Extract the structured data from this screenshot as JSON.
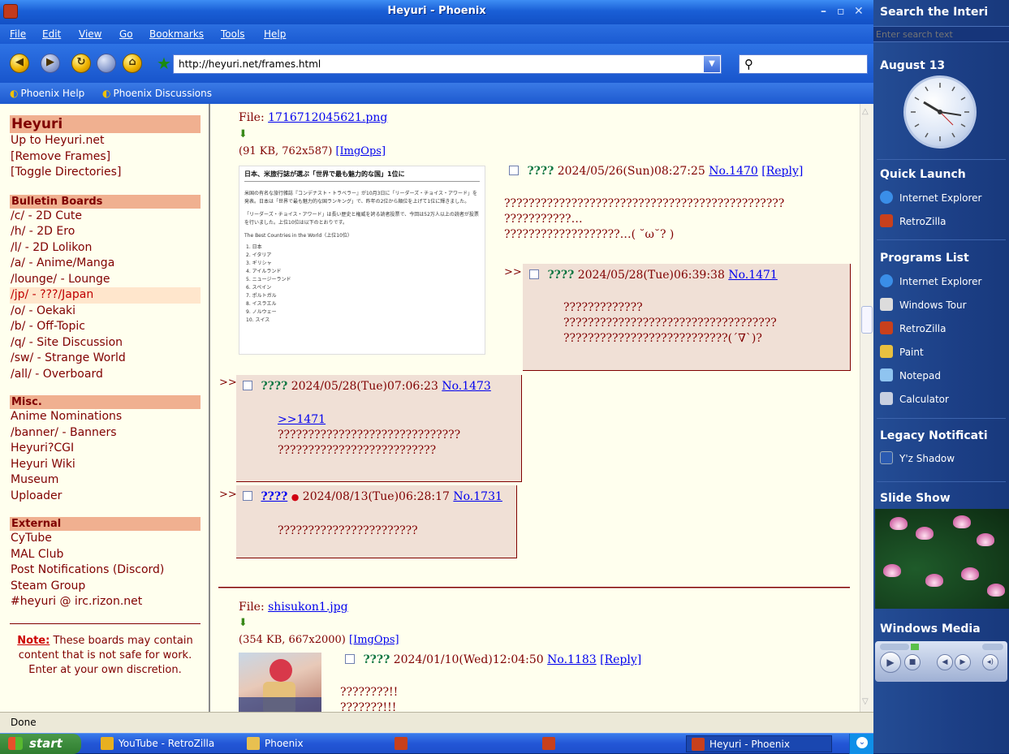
{
  "window": {
    "title": "Heyuri - Phoenix"
  },
  "menu": [
    "File",
    "Edit",
    "View",
    "Go",
    "Bookmarks",
    "Tools",
    "Help"
  ],
  "toolbar": {
    "url": "http://heyuri.net/frames.html",
    "search_value": ""
  },
  "bookmarks": [
    "Phoenix Help",
    "Phoenix Discussions"
  ],
  "nav": {
    "site_title": "Heyuri",
    "top_links": [
      "Up to Heyuri.net",
      "[Remove Frames]",
      "[Toggle Directories]"
    ],
    "boards_header": "Bulletin Boards",
    "boards": [
      "/c/ - 2D Cute",
      "/h/ - 2D Ero",
      "/l/ - 2D Lolikon",
      "/a/ - Anime/Manga",
      "/lounge/ - Lounge",
      "/jp/ - ???/Japan",
      "/o/ - Oekaki",
      "/b/ - Off-Topic",
      "/q/ - Site Discussion",
      "/sw/ - Strange World",
      "/all/ - Overboard"
    ],
    "misc_header": "Misc.",
    "misc": [
      "Anime Nominations",
      "/banner/ - Banners",
      "Heyuri?CGI",
      "Heyuri Wiki",
      "Museum",
      "Uploader"
    ],
    "external_header": "External",
    "external": [
      "CyTube",
      "MAL Club",
      "Post Notifications (Discord)",
      "Steam Group",
      "#heyuri @ irc.rizon.net"
    ],
    "note_label": "Note:",
    "note_text": "These boards may contain content that is not safe for work. Enter at your own discretion."
  },
  "thread1": {
    "file_label": "File:",
    "file_name": "1716712045621.png",
    "file_meta": "(91 KB, 762x587)",
    "imgops": "[ImgOps]",
    "thumb_heading": "日本、米旅行誌が選ぶ「世界で最も魅力的な国」1位に",
    "thumb_para1": "米国の有名な旅行雑誌『コンデナスト・トラベラー』が10月3日に「リーダーズ・チョイス・アワード」を発表。日本は「世界で最も魅力的な国ランキング」で、昨年の2位から順位を上げて1位に輝きました。",
    "thumb_para2": "「リーダーズ・チョイス・アワード」は長い歴史と権威を誇る読者投票で、今回は52万人以上の読者が投票を行いました。上位10位は以下のとおりです。",
    "thumb_list_title": "The Best Countries in the World（上位10位）",
    "thumb_list": [
      "1. 日本",
      "2. イタリア",
      "3. ギリシャ",
      "4. アイルランド",
      "5. ニュージーランド",
      "6. スペイン",
      "7. ポルトガル",
      "8. イスラエル",
      "9. ノルウェー",
      "10. スイス"
    ],
    "op": {
      "name": "????",
      "date": "2024/05/26(Sun)08:27:25",
      "no": "No.1470",
      "reply": "[Reply]",
      "lines": [
        "??????????????????????????????????????????????",
        "???????????…",
        "???????????????????…( ˘ω˘? )"
      ]
    },
    "replies": [
      {
        "name": "????",
        "date": "2024/05/28(Tue)06:39:38",
        "no": "No.1471",
        "lines": [
          "?????????????",
          "???????????????????????????????????",
          "???????????????????????????(´∇`)?"
        ]
      },
      {
        "name": "????",
        "date": "2024/05/28(Tue)07:06:23",
        "no": "No.1473",
        "quote": ">>1471",
        "lines": [
          "??????????????????????????????",
          "??????????????????????????"
        ]
      },
      {
        "name": "????",
        "flag": "●",
        "date": "2024/08/13(Tue)06:28:17",
        "no": "No.1731",
        "lines": [
          "???????????????????????"
        ]
      }
    ],
    "arrow": ">>"
  },
  "thread2": {
    "file_label": "File:",
    "file_name": "shisukon1.jpg",
    "file_meta": "(354 KB, 667x2000)",
    "imgops": "[ImgOps]",
    "op": {
      "name": "????",
      "date": "2024/01/10(Wed)12:04:50",
      "no": "No.1183",
      "reply": "[Reply]",
      "lines": [
        "????????!!",
        "???????!!!"
      ]
    }
  },
  "status": "Done",
  "sidebar": {
    "search_title": "Search the Interi",
    "search_placeholder": "Enter search text",
    "date": "August 13",
    "quick_launch": "Quick Launch",
    "quick_items": [
      "Internet Explorer",
      "RetroZilla"
    ],
    "programs": "Programs List",
    "program_items": [
      "Internet Explorer",
      "Windows Tour",
      "RetroZilla",
      "Paint",
      "Notepad",
      "Calculator"
    ],
    "legacy": "Legacy Notificati",
    "legacy_items": [
      "Y'z Shadow"
    ],
    "slideshow": "Slide Show",
    "media": "Windows Media"
  },
  "taskbar": {
    "start": "start",
    "tasks": [
      "YouTube - RetroZilla",
      "Phoenix",
      "",
      "",
      "Heyuri - Phoenix"
    ]
  }
}
